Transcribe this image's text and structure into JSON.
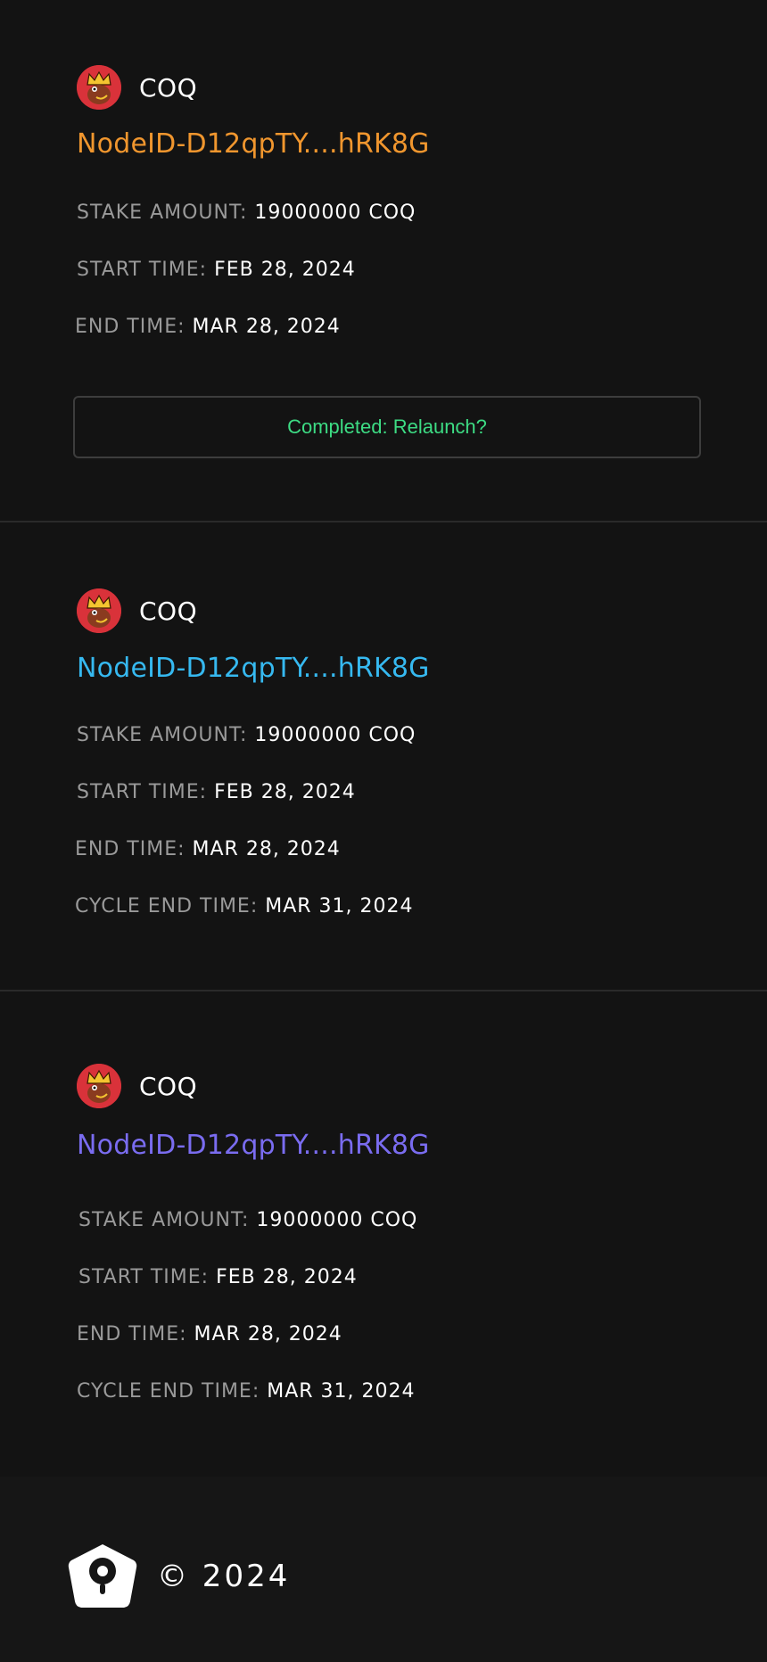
{
  "validators": [
    {
      "token": "COQ",
      "node_id": "NodeID-D12qpTY....hRK8G",
      "node_color": "#f0962e",
      "stake_label": "STAKE AMOUNT:",
      "stake_value": "19000000 COQ",
      "start_label": "START TIME:",
      "start_value": "FEB 28, 2024",
      "end_label": "END TIME:",
      "end_value": "MAR 28, 2024",
      "action_label": "Completed: Relaunch?"
    },
    {
      "token": "COQ",
      "node_id": "NodeID-D12qpTY....hRK8G",
      "node_color": "#36b9f0",
      "stake_label": "STAKE AMOUNT:",
      "stake_value": "19000000 COQ",
      "start_label": "START TIME:",
      "start_value": "FEB 28, 2024",
      "end_label": "END TIME:",
      "end_value": "MAR 28, 2024",
      "cycle_label": "CYCLE END TIME:",
      "cycle_value": "MAR 31, 2024"
    },
    {
      "token": "COQ",
      "node_id": "NodeID-D12qpTY....hRK8G",
      "node_color": "#7a6cf0",
      "stake_label": "STAKE AMOUNT:",
      "stake_value": "19000000 COQ",
      "start_label": "START TIME:",
      "start_value": "FEB 28, 2024",
      "end_label": "END TIME:",
      "end_value": "MAR 28, 2024",
      "cycle_label": "CYCLE END TIME:",
      "cycle_value": "MAR 31, 2024"
    }
  ],
  "footer": {
    "copyright": "© 2024",
    "logo_icon": "pin-pentagon-icon"
  },
  "colors": {
    "background": "#131313",
    "label": "#9a9a9a",
    "action": "#3ddc84"
  }
}
